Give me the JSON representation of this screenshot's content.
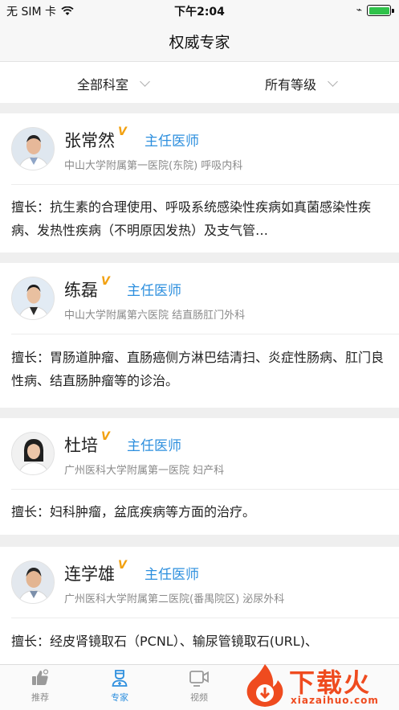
{
  "status_bar": {
    "carrier": "无 SIM 卡",
    "time": "下午2:04"
  },
  "nav": {
    "title": "权威专家"
  },
  "filters": {
    "department": "全部科室",
    "level": "所有等级"
  },
  "doctors": [
    {
      "name": "张常然",
      "badge": "V",
      "title": "主任医师",
      "hospital": "中山大学附属第一医院(东院) 呼吸内科",
      "expertise": "擅长：抗生素的合理使用、呼吸系统感染性疾病如真菌感染性疾病、发热性疾病（不明原因发热）及支气管…"
    },
    {
      "name": "练磊",
      "badge": "V",
      "title": "主任医师",
      "hospital": "中山大学附属第六医院 结直肠肛门外科",
      "expertise": "擅长：胃肠道肿瘤、直肠癌侧方淋巴结清扫、炎症性肠病、肛门良性病、结直肠肿瘤等的诊治。"
    },
    {
      "name": "杜培",
      "badge": "V",
      "title": "主任医师",
      "hospital": "广州医科大学附属第一医院 妇产科",
      "expertise": "擅长：妇科肿瘤，盆底疾病等方面的治疗。"
    },
    {
      "name": "连学雄",
      "badge": "V",
      "title": "主任医师",
      "hospital": "广州医科大学附属第二医院(番禺院区) 泌尿外科",
      "expertise": "擅长：经皮肾镜取石（PCNL）、输尿管镜取石(URL)、"
    }
  ],
  "tabs": [
    {
      "label": "推荐",
      "icon": "thumbs-up-icon"
    },
    {
      "label": "专家",
      "icon": "doctor-icon"
    },
    {
      "label": "视频",
      "icon": "video-icon"
    }
  ],
  "watermark": {
    "text": "下载火",
    "sub": "xiazaihuo.com"
  },
  "colors": {
    "accent": "#2d8fde",
    "badge": "#f2a111",
    "watermark": "#ef4b1f"
  }
}
